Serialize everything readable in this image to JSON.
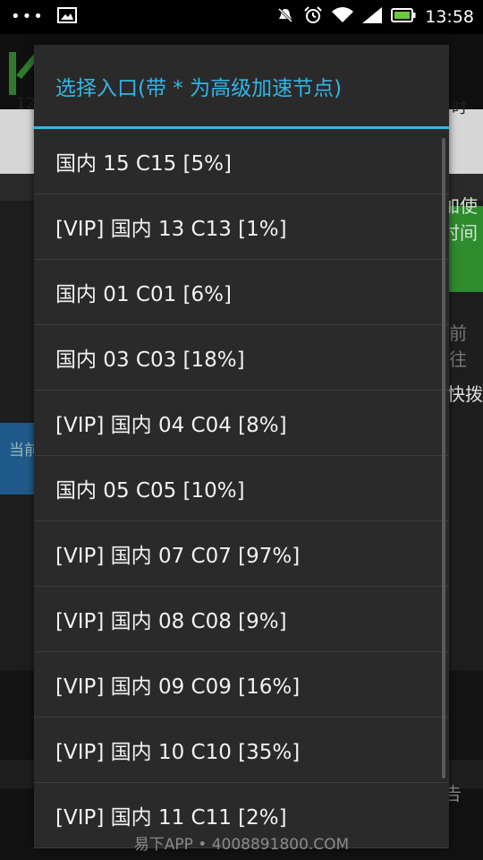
{
  "status_bar": {
    "time": "13:58",
    "icons": [
      "more-dots-icon",
      "image-icon",
      "mute-icon",
      "alarm-icon",
      "wifi-icon",
      "signal-icon",
      "battery-icon"
    ]
  },
  "background": {
    "row1_left": "12",
    "row1_right": "时",
    "green_button_line1": "加使",
    "green_button_line2": "时间",
    "side_text_1": "前往",
    "side_text_2": "快拨",
    "left_label": "当前",
    "bottom_text": "告"
  },
  "dialog": {
    "title": "选择入口(带 * 为高级加速节点)",
    "options": [
      {
        "label": "国内 15 C15 [5%]"
      },
      {
        "label": "[VIP] 国内 13 C13 [1%]"
      },
      {
        "label": "国内 01 C01 [6%]"
      },
      {
        "label": "国内 03 C03 [18%]"
      },
      {
        "label": "[VIP] 国内 04 C04 [8%]"
      },
      {
        "label": "国内 05 C05 [10%]"
      },
      {
        "label": "[VIP] 国内 07 C07 [97%]"
      },
      {
        "label": "[VIP] 国内 08 C08 [9%]"
      },
      {
        "label": "[VIP] 国内 09 C09 [16%]"
      },
      {
        "label": "[VIP] 国内 10 C10 [35%]"
      },
      {
        "label": "[VIP] 国内 11 C11 [2%]"
      }
    ]
  },
  "watermark": "易下APP • 4008891800.COM",
  "colors": {
    "accent": "#33b5e5",
    "dialog_bg": "#2a2a2a",
    "green_button": "#2e8b2e"
  }
}
